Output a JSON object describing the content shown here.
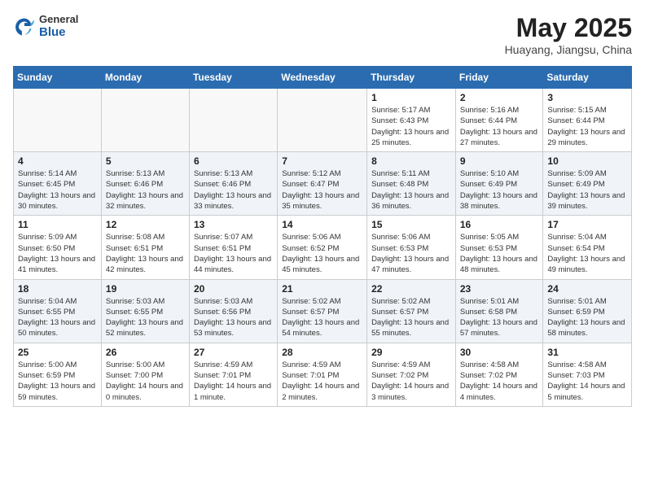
{
  "header": {
    "logo_general": "General",
    "logo_blue": "Blue",
    "month_year": "May 2025",
    "location": "Huayang, Jiangsu, China"
  },
  "days_of_week": [
    "Sunday",
    "Monday",
    "Tuesday",
    "Wednesday",
    "Thursday",
    "Friday",
    "Saturday"
  ],
  "weeks": [
    {
      "shaded": false,
      "days": [
        {
          "num": "",
          "info": ""
        },
        {
          "num": "",
          "info": ""
        },
        {
          "num": "",
          "info": ""
        },
        {
          "num": "",
          "info": ""
        },
        {
          "num": "1",
          "info": "Sunrise: 5:17 AM\nSunset: 6:43 PM\nDaylight: 13 hours\nand 25 minutes."
        },
        {
          "num": "2",
          "info": "Sunrise: 5:16 AM\nSunset: 6:44 PM\nDaylight: 13 hours\nand 27 minutes."
        },
        {
          "num": "3",
          "info": "Sunrise: 5:15 AM\nSunset: 6:44 PM\nDaylight: 13 hours\nand 29 minutes."
        }
      ]
    },
    {
      "shaded": true,
      "days": [
        {
          "num": "4",
          "info": "Sunrise: 5:14 AM\nSunset: 6:45 PM\nDaylight: 13 hours\nand 30 minutes."
        },
        {
          "num": "5",
          "info": "Sunrise: 5:13 AM\nSunset: 6:46 PM\nDaylight: 13 hours\nand 32 minutes."
        },
        {
          "num": "6",
          "info": "Sunrise: 5:13 AM\nSunset: 6:46 PM\nDaylight: 13 hours\nand 33 minutes."
        },
        {
          "num": "7",
          "info": "Sunrise: 5:12 AM\nSunset: 6:47 PM\nDaylight: 13 hours\nand 35 minutes."
        },
        {
          "num": "8",
          "info": "Sunrise: 5:11 AM\nSunset: 6:48 PM\nDaylight: 13 hours\nand 36 minutes."
        },
        {
          "num": "9",
          "info": "Sunrise: 5:10 AM\nSunset: 6:49 PM\nDaylight: 13 hours\nand 38 minutes."
        },
        {
          "num": "10",
          "info": "Sunrise: 5:09 AM\nSunset: 6:49 PM\nDaylight: 13 hours\nand 39 minutes."
        }
      ]
    },
    {
      "shaded": false,
      "days": [
        {
          "num": "11",
          "info": "Sunrise: 5:09 AM\nSunset: 6:50 PM\nDaylight: 13 hours\nand 41 minutes."
        },
        {
          "num": "12",
          "info": "Sunrise: 5:08 AM\nSunset: 6:51 PM\nDaylight: 13 hours\nand 42 minutes."
        },
        {
          "num": "13",
          "info": "Sunrise: 5:07 AM\nSunset: 6:51 PM\nDaylight: 13 hours\nand 44 minutes."
        },
        {
          "num": "14",
          "info": "Sunrise: 5:06 AM\nSunset: 6:52 PM\nDaylight: 13 hours\nand 45 minutes."
        },
        {
          "num": "15",
          "info": "Sunrise: 5:06 AM\nSunset: 6:53 PM\nDaylight: 13 hours\nand 47 minutes."
        },
        {
          "num": "16",
          "info": "Sunrise: 5:05 AM\nSunset: 6:53 PM\nDaylight: 13 hours\nand 48 minutes."
        },
        {
          "num": "17",
          "info": "Sunrise: 5:04 AM\nSunset: 6:54 PM\nDaylight: 13 hours\nand 49 minutes."
        }
      ]
    },
    {
      "shaded": true,
      "days": [
        {
          "num": "18",
          "info": "Sunrise: 5:04 AM\nSunset: 6:55 PM\nDaylight: 13 hours\nand 50 minutes."
        },
        {
          "num": "19",
          "info": "Sunrise: 5:03 AM\nSunset: 6:55 PM\nDaylight: 13 hours\nand 52 minutes."
        },
        {
          "num": "20",
          "info": "Sunrise: 5:03 AM\nSunset: 6:56 PM\nDaylight: 13 hours\nand 53 minutes."
        },
        {
          "num": "21",
          "info": "Sunrise: 5:02 AM\nSunset: 6:57 PM\nDaylight: 13 hours\nand 54 minutes."
        },
        {
          "num": "22",
          "info": "Sunrise: 5:02 AM\nSunset: 6:57 PM\nDaylight: 13 hours\nand 55 minutes."
        },
        {
          "num": "23",
          "info": "Sunrise: 5:01 AM\nSunset: 6:58 PM\nDaylight: 13 hours\nand 57 minutes."
        },
        {
          "num": "24",
          "info": "Sunrise: 5:01 AM\nSunset: 6:59 PM\nDaylight: 13 hours\nand 58 minutes."
        }
      ]
    },
    {
      "shaded": false,
      "days": [
        {
          "num": "25",
          "info": "Sunrise: 5:00 AM\nSunset: 6:59 PM\nDaylight: 13 hours\nand 59 minutes."
        },
        {
          "num": "26",
          "info": "Sunrise: 5:00 AM\nSunset: 7:00 PM\nDaylight: 14 hours\nand 0 minutes."
        },
        {
          "num": "27",
          "info": "Sunrise: 4:59 AM\nSunset: 7:01 PM\nDaylight: 14 hours\nand 1 minute."
        },
        {
          "num": "28",
          "info": "Sunrise: 4:59 AM\nSunset: 7:01 PM\nDaylight: 14 hours\nand 2 minutes."
        },
        {
          "num": "29",
          "info": "Sunrise: 4:59 AM\nSunset: 7:02 PM\nDaylight: 14 hours\nand 3 minutes."
        },
        {
          "num": "30",
          "info": "Sunrise: 4:58 AM\nSunset: 7:02 PM\nDaylight: 14 hours\nand 4 minutes."
        },
        {
          "num": "31",
          "info": "Sunrise: 4:58 AM\nSunset: 7:03 PM\nDaylight: 14 hours\nand 5 minutes."
        }
      ]
    }
  ]
}
